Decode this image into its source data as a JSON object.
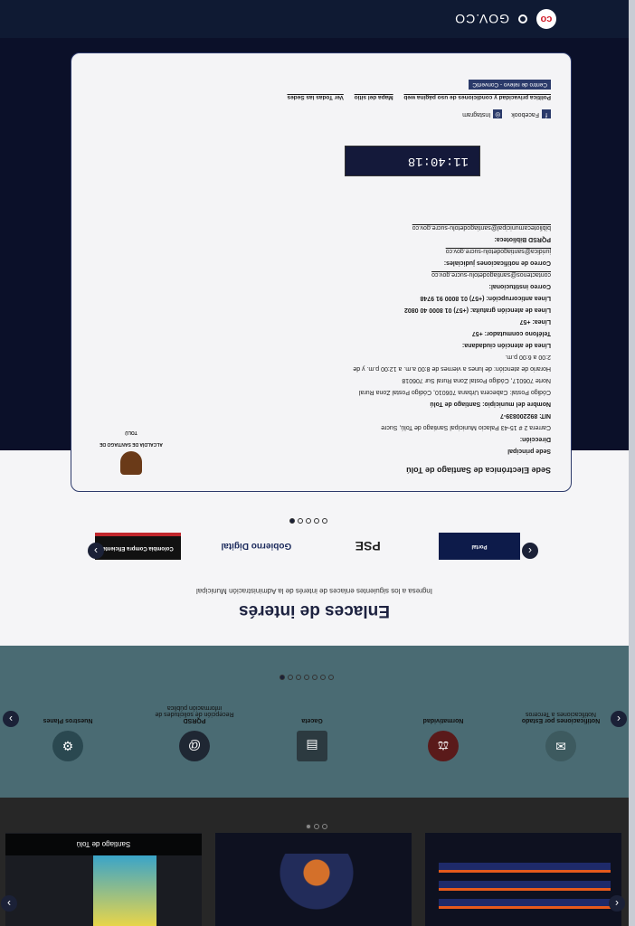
{
  "govbar": {
    "brand": "GOV.CO",
    "logo": "co"
  },
  "news": {
    "cards": [
      {
        "caption": "Santiago de Tolú"
      },
      {
        "caption": ""
      },
      {
        "caption": ""
      }
    ]
  },
  "services": {
    "items": [
      {
        "icon": "notification-icon",
        "title": "Notificaciones por Estado",
        "subtitle": "Notificaciones a Terceros"
      },
      {
        "icon": "law-icon",
        "title": "Normatividad",
        "subtitle": ""
      },
      {
        "icon": "gazette-icon",
        "title": "Gaceta",
        "subtitle": ""
      },
      {
        "icon": "mail-icon",
        "title": "PQRSD",
        "subtitle": "Recepción de solicitudes de información pública"
      },
      {
        "icon": "gear-icon",
        "title": "Nuestros Planes",
        "subtitle": ""
      }
    ]
  },
  "enlaces": {
    "title": "Enlaces de interés",
    "subtitle": "Ingresa a los siguientes enlaces de interés de la Administración Municipal",
    "partners": [
      "Colombia Compra Eficiente",
      "Gobierno Digital",
      "PSE",
      "Portal"
    ]
  },
  "footer": {
    "sede_title": "Sede Electrónica de Santiago de Tolú",
    "seal_text": "ALCALDÍA DE SANTIAGO DE TOLÚ",
    "sede_principal": "Sede principal",
    "direccion_label": "Dirección:",
    "direccion": "Carrera 2 # 15-43 Palacio Municipal Santiago de Tolú, Sucre",
    "nit": "NIT: 892200839-7",
    "nombre": "Nombre del municipio: Santiago de Tolú",
    "codigo": "Código Postal: Cabecera Urbana 706010, Código Postal Zona Rural Norte 706017, Código Postal Zona Rural Sur 706018",
    "horario": "Horario de atención: de lunes a viernes de 8:00 a.m. a 12:00 p.m. y de 2:00 a 6:00 p.m.",
    "linea_ciudadano": "Línea de atención ciudadana:",
    "telefono": "Teléfono conmutador: +57",
    "linea": "Línea: +57",
    "gratuita": "Línea de atención gratuita: (+57) 01 8000 40 0802",
    "anticorrupcion": "Línea anticorrupción: (+57) 01 8000 91 9748",
    "correo_inst_label": "Correo institucional:",
    "correo_inst": "contactenos@santiagodetolu-sucre.gov.co",
    "correo_jud_label": "Correo de notificaciones judiciales:",
    "correo_jud": "juridica@santiagodetolu-sucre.gov.co",
    "pqrsd_label": "PQRSD Biblioteca:",
    "pqrsd": "bibliotecamunicipal@santiagodetolu-sucre.gov.co",
    "clock": "11:40:18",
    "social": [
      "Facebook",
      "Instagram"
    ],
    "links": [
      "Política privacidad y condiciones de uso página web",
      "Mapa del sitio",
      "Ver Todas las Sedes"
    ],
    "centro": "Centro de relevo - ConvertiC"
  }
}
